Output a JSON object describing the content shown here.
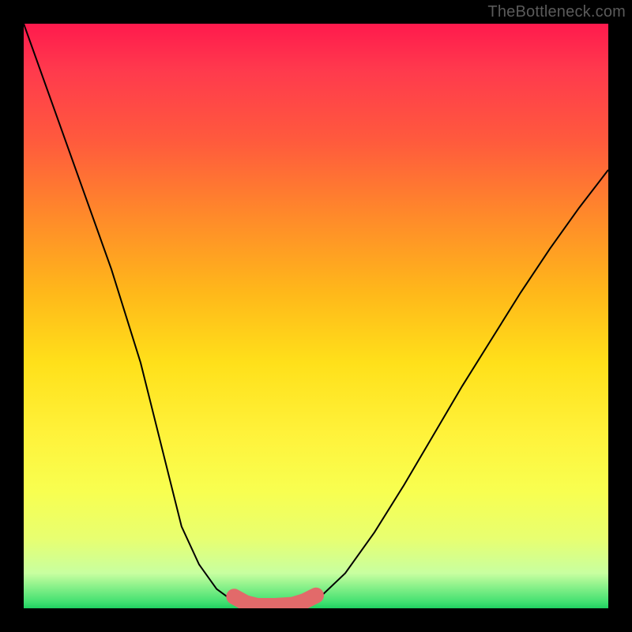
{
  "attribution": "TheBottleneck.com",
  "chart_data": {
    "type": "line",
    "title": "",
    "xlabel": "",
    "ylabel": "",
    "xlim": [
      0,
      100
    ],
    "ylim": [
      0,
      100
    ],
    "series": [
      {
        "name": "left-curve",
        "x": [
          0,
          5,
          10,
          15,
          20,
          25,
          27,
          30,
          33,
          36,
          38,
          40
        ],
        "y": [
          100,
          86,
          72,
          58,
          42,
          22,
          14,
          7.5,
          3.3,
          1.1,
          0.4,
          0
        ]
      },
      {
        "name": "right-curve",
        "x": [
          46,
          49,
          51,
          55,
          60,
          65,
          70,
          75,
          80,
          85,
          90,
          95,
          100
        ],
        "y": [
          0,
          1,
          2.2,
          6,
          13,
          21,
          29.5,
          38,
          46,
          54,
          61.5,
          68.5,
          75
        ]
      },
      {
        "name": "highlight-segment",
        "style": "thick-pink",
        "x": [
          36,
          38,
          40,
          43,
          46,
          48,
          50
        ],
        "y": [
          2.0,
          0.9,
          0.4,
          0.4,
          0.6,
          1.2,
          2.2
        ]
      }
    ],
    "background": "rainbow-vertical",
    "colors": {
      "curve": "#000000",
      "highlight": "#e26a6a"
    }
  }
}
